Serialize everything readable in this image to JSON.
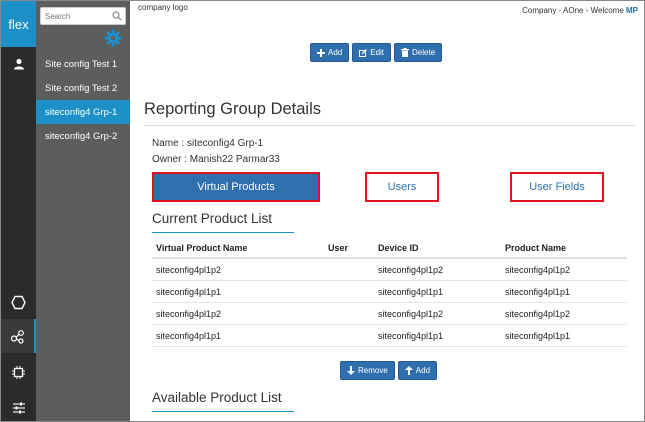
{
  "app": {
    "logo": "flex"
  },
  "header": {
    "company_logo": "company logo",
    "welcome": "Company - AOne - Welcome ",
    "user_initials": "MP"
  },
  "search": {
    "placeholder": "Search"
  },
  "sidebar": {
    "items": [
      {
        "label": "Site config Test 1"
      },
      {
        "label": "Site config Test 2"
      },
      {
        "label": "siteconfig4 Grp-1"
      },
      {
        "label": "siteconfig4 Grp-2"
      }
    ]
  },
  "toolbar": {
    "add_label": "Add",
    "edit_label": "Edit",
    "delete_label": "Delete"
  },
  "page": {
    "title": "Reporting Group Details",
    "name_line": "Name : siteconfig4 Grp-1",
    "owner_line": "Owner : Manish22 Parmar33"
  },
  "tabs": {
    "virtual_products": "Virtual Products",
    "users": "Users",
    "user_fields": "User Fields"
  },
  "current_list": {
    "title": "Current Product List",
    "columns": [
      "Virtual Product Name",
      "User",
      "Device ID",
      "Product Name"
    ],
    "rows": [
      [
        "siteconfig4pl1p2",
        "",
        "siteconfig4pl1p2",
        "siteconfig4pl1p2"
      ],
      [
        "siteconfig4pl1p1",
        "",
        "siteconfig4pl1p1",
        "siteconfig4pl1p1"
      ],
      [
        "siteconfig4pl1p2",
        "",
        "siteconfig4pl1p2",
        "siteconfig4pl1p2"
      ],
      [
        "siteconfig4pl1p1",
        "",
        "siteconfig4pl1p1",
        "siteconfig4pl1p1"
      ]
    ],
    "remove_label": "Remove",
    "add_label": "Add"
  },
  "available_list": {
    "title": "Available Product List"
  },
  "colors": {
    "accent": "#1e90c8",
    "button": "#2f6fae",
    "highlight_border": "#e0141e",
    "rail": "#2b2b2b",
    "sidebar": "#5d5d5d"
  },
  "icons": [
    "search-icon",
    "gear-icon",
    "user-icon",
    "hexagon-icon",
    "share-nodes-icon",
    "chip-icon",
    "sliders-icon",
    "plus-icon",
    "edit-icon",
    "trash-icon",
    "arrow-down-icon",
    "arrow-up-icon"
  ]
}
